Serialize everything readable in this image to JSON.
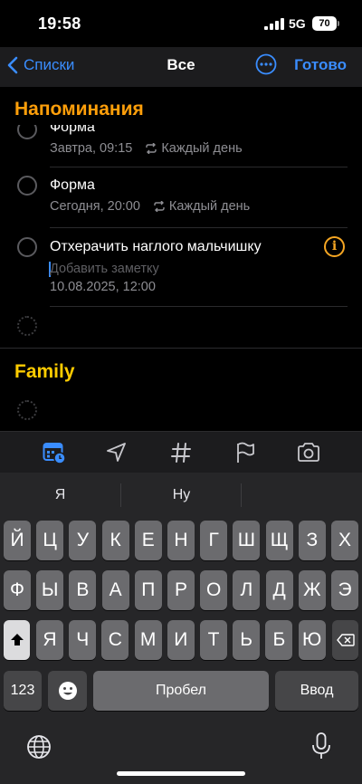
{
  "status": {
    "time": "19:58",
    "network": "5G",
    "battery": "70"
  },
  "nav": {
    "back_label": "Списки",
    "title": "Все",
    "done_label": "Готово"
  },
  "sections": [
    {
      "title": "Напоминания",
      "color": "#ff9f0a"
    },
    {
      "title": "Family",
      "color": "#ffcc00"
    }
  ],
  "reminders": [
    {
      "title": "Форма",
      "date": "Завтра, 09:15",
      "repeat": "Каждый день"
    },
    {
      "title": "Форма",
      "date": "Сегодня, 20:00",
      "repeat": "Каждый день"
    },
    {
      "title": "Отхерачить наглого мальчишку",
      "note_placeholder": "Добавить заметку",
      "date": "10.08.2025, 12:00"
    }
  ],
  "toolbar": {
    "icons": [
      "calendar-clock-icon",
      "location-arrow-icon",
      "hashtag-icon",
      "flag-icon",
      "camera-icon"
    ]
  },
  "keyboard": {
    "predictions": [
      "Я",
      "Ну",
      ""
    ],
    "row1": [
      "Й",
      "Ц",
      "У",
      "К",
      "Е",
      "Н",
      "Г",
      "Ш",
      "Щ",
      "З",
      "Х"
    ],
    "row2": [
      "Ф",
      "Ы",
      "В",
      "А",
      "П",
      "Р",
      "О",
      "Л",
      "Д",
      "Ж",
      "Э"
    ],
    "row3": [
      "Я",
      "Ч",
      "С",
      "М",
      "И",
      "Т",
      "Ь",
      "Б",
      "Ю"
    ],
    "numbers_label": "123",
    "space_label": "Пробел",
    "return_label": "Ввод"
  },
  "colors": {
    "accent": "#3a8dff",
    "info": "#f5a623"
  }
}
